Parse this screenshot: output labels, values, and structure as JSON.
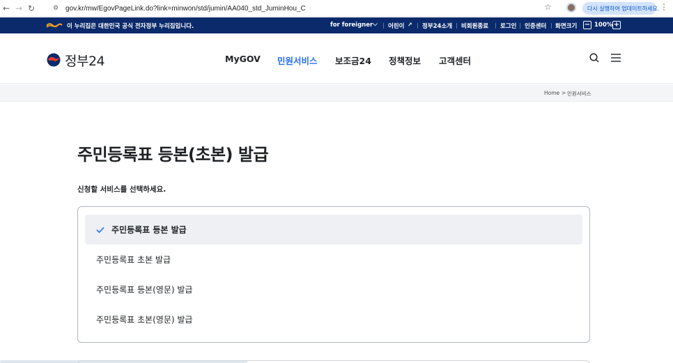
{
  "browser": {
    "url": "gov.kr/mw/EgovPageLink.do?link=minwon/std/jumin/AA040_std_JuminHou_C",
    "update_button": "다시 실행하여 업데이트하세요.",
    "icons": [
      "back-icon",
      "forward-icon",
      "reload-icon",
      "site-info-icon",
      "bookmark-star-icon",
      "kebab-menu-icon"
    ]
  },
  "gov_bar": {
    "notice": "이 누리집은 대한민국 공식 전자정부 누리집입니다.",
    "links": {
      "foreigner": "for foreigner",
      "kids": "어린이",
      "about": "정부24소개",
      "nonmember": "비회원종료",
      "login": "로그인",
      "cert": "인증센터",
      "zoom_label": "화면크기",
      "zoom_minus": "−",
      "zoom_value": "100%",
      "zoom_plus": "+"
    },
    "chevron": "⌵"
  },
  "header": {
    "logo_text": "정부24",
    "nav": [
      {
        "label": "MyGOV",
        "active": false
      },
      {
        "label": "민원서비스",
        "active": true
      },
      {
        "label": "보조금24",
        "active": false
      },
      {
        "label": "정책정보",
        "active": false
      },
      {
        "label": "고객센터",
        "active": false
      }
    ]
  },
  "breadcrumb": {
    "home": "Home",
    "separator": ">",
    "current": "민원서비스"
  },
  "main": {
    "title": "주민등록표 등본(초본) 발급",
    "section_label": "신청할 서비스를 선택하세요.",
    "options": [
      {
        "label": "주민등록표 등본 발급",
        "selected": true
      },
      {
        "label": "주민등록표 초본 발급",
        "selected": false
      },
      {
        "label": "주민등록표 등본(영문) 발급",
        "selected": false
      },
      {
        "label": "주민등록표 초본(영문) 발급",
        "selected": false
      }
    ]
  },
  "colors": {
    "gov_bar": "#0b2a6b",
    "accent": "#256ef4",
    "selected_bg": "#eef0f3"
  }
}
